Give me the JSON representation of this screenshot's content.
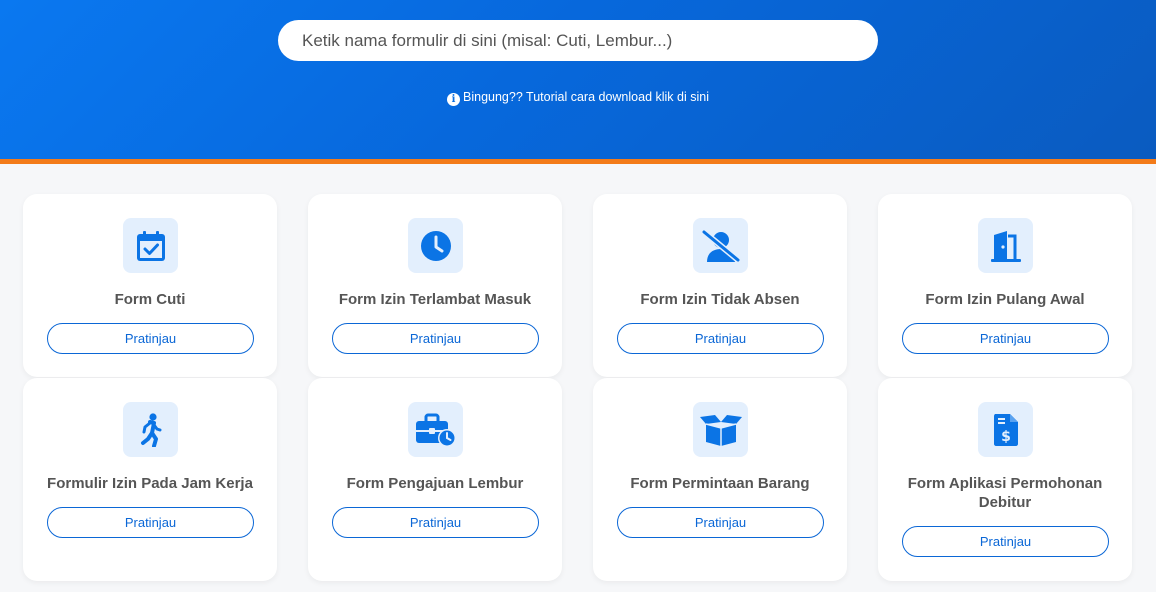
{
  "search": {
    "placeholder": "Ketik nama formulir di sini (misal: Cuti, Lembur...)"
  },
  "help": {
    "text": "Bingung?? Tutorial cara download klik di sini"
  },
  "colors": {
    "primary": "#0a6ee0",
    "accent_stripe": "#f37b1a",
    "icon_bg": "#e3effd"
  },
  "cards": [
    {
      "title": "Form Cuti",
      "button": "Pratinjau",
      "icon": "calendar-check-icon"
    },
    {
      "title": "Form Izin Terlambat Masuk",
      "button": "Pratinjau",
      "icon": "clock-icon"
    },
    {
      "title": "Form Izin Tidak Absen",
      "button": "Pratinjau",
      "icon": "user-slash-icon"
    },
    {
      "title": "Form Izin Pulang Awal",
      "button": "Pratinjau",
      "icon": "door-open-icon"
    },
    {
      "title": "Formulir Izin Pada Jam Kerja",
      "button": "Pratinjau",
      "icon": "walking-person-icon"
    },
    {
      "title": "Form Pengajuan Lembur",
      "button": "Pratinjau",
      "icon": "briefcase-clock-icon"
    },
    {
      "title": "Form Permintaan Barang",
      "button": "Pratinjau",
      "icon": "box-open-icon"
    },
    {
      "title": "Form Aplikasi Permohonan Debitur",
      "button": "Pratinjau",
      "icon": "file-invoice-dollar-icon"
    }
  ]
}
